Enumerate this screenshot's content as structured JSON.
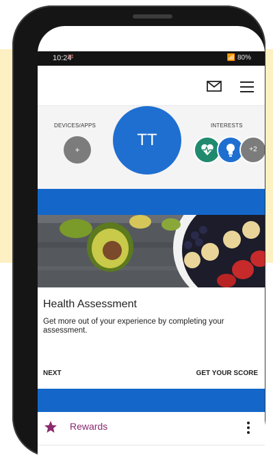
{
  "status_bar": {
    "time": "10:24",
    "battery": "80%"
  },
  "header": {
    "mail_icon": "mail-icon",
    "menu_icon": "hamburger-menu-icon"
  },
  "profile": {
    "devices_label": "DEVICES/APPS",
    "add_device_label": "+",
    "avatar_initials": "TT",
    "interests_label": "INTERESTS",
    "interests": [
      {
        "icon": "heart-pulse-icon",
        "color": "#1f8a6e"
      },
      {
        "icon": "lightbulb-icon",
        "color": "#1f6fd1"
      }
    ],
    "interests_more": "+2"
  },
  "card": {
    "title": "Health Assessment",
    "description": "Get more out of your experience by completing your assessment.",
    "next_label": "NEXT",
    "score_label": "GET YOUR SCORE"
  },
  "rewards": {
    "label": "Rewards",
    "icon": "star-icon",
    "color": "#8a2a6f"
  },
  "colors": {
    "brand_blue": "#1467c8",
    "accent": "#1f6fd1",
    "background": "#fdf0c2"
  }
}
